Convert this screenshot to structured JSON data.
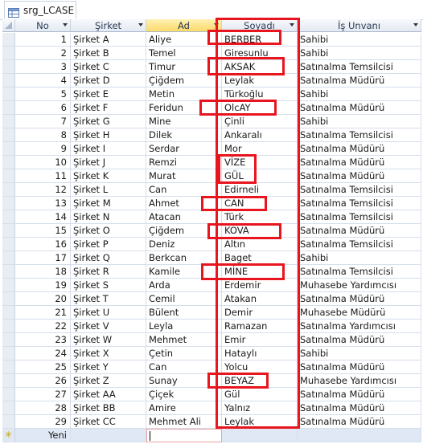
{
  "tab": {
    "label": "srg_LCASE",
    "icon": "table-icon"
  },
  "columns": [
    {
      "key": "no",
      "label": "No"
    },
    {
      "key": "sirket",
      "label": "Şirket"
    },
    {
      "key": "ad",
      "label": "Ad"
    },
    {
      "key": "soyadi",
      "label": "Soyadı"
    },
    {
      "key": "unvan",
      "label": "İş Unvanı"
    }
  ],
  "rows": [
    {
      "no": "1",
      "sirket": "Şirket A",
      "ad": "Aliye",
      "soyadi": "BERBER",
      "unvan": "Sahibi"
    },
    {
      "no": "2",
      "sirket": "Şirket B",
      "ad": "Temel",
      "soyadi": "Giresunlu",
      "unvan": "Sahibi"
    },
    {
      "no": "3",
      "sirket": "Şirket C",
      "ad": "Timur",
      "soyadi": "AKSAK",
      "unvan": "Satınalma Temsilcisi"
    },
    {
      "no": "4",
      "sirket": "Şirket D",
      "ad": "Çiğdem",
      "soyadi": "Leylak",
      "unvan": "Satınalma Müdürü"
    },
    {
      "no": "5",
      "sirket": "Şirket E",
      "ad": "Metin",
      "soyadi": "Türkoğlu",
      "unvan": "Sahibi"
    },
    {
      "no": "6",
      "sirket": "Şirket F",
      "ad": "Feridun",
      "soyadi": "OlcAY",
      "unvan": "Satınalma Müdürü"
    },
    {
      "no": "7",
      "sirket": "Şirket G",
      "ad": "Mine",
      "soyadi": "Çinli",
      "unvan": "Sahibi"
    },
    {
      "no": "8",
      "sirket": "Şirket H",
      "ad": "Dilek",
      "soyadi": "Ankaralı",
      "unvan": "Satınalma Temsilcisi"
    },
    {
      "no": "9",
      "sirket": "Şirket I",
      "ad": "Serdar",
      "soyadi": "Mor",
      "unvan": "Satınalma Müdürü"
    },
    {
      "no": "10",
      "sirket": "Şirket J",
      "ad": "Remzi",
      "soyadi": "VİZE",
      "unvan": "Satınalma Müdürü"
    },
    {
      "no": "11",
      "sirket": "Şirket K",
      "ad": "Murat",
      "soyadi": "GÜL",
      "unvan": "Satınalma Müdürü"
    },
    {
      "no": "12",
      "sirket": "Şirket L",
      "ad": "Can",
      "soyadi": "Edirneli",
      "unvan": "Satınalma Temsilcisi"
    },
    {
      "no": "13",
      "sirket": "Şirket M",
      "ad": "Ahmet",
      "soyadi": "CAN",
      "unvan": "Satınalma Temsilcisi"
    },
    {
      "no": "14",
      "sirket": "Şirket N",
      "ad": "Atacan",
      "soyadi": "Türk",
      "unvan": "Satınalma Temsilcisi"
    },
    {
      "no": "15",
      "sirket": "Şirket O",
      "ad": "Çiğdem",
      "soyadi": "KOVA",
      "unvan": "Satınalma Müdürü"
    },
    {
      "no": "16",
      "sirket": "Şirket P",
      "ad": "Deniz",
      "soyadi": "Altın",
      "unvan": "Satınalma Temsilcisi"
    },
    {
      "no": "17",
      "sirket": "Şirket Q",
      "ad": "Berkcan",
      "soyadi": "Baget",
      "unvan": "Sahibi"
    },
    {
      "no": "18",
      "sirket": "Şirket R",
      "ad": "Kamile",
      "soyadi": "MİNE",
      "unvan": "Satınalma Temsilcisi"
    },
    {
      "no": "19",
      "sirket": "Şirket S",
      "ad": "Arda",
      "soyadi": "Erdemir",
      "unvan": "Muhasebe Yardımcısı"
    },
    {
      "no": "20",
      "sirket": "Şirket T",
      "ad": "Cemil",
      "soyadi": "Atakan",
      "unvan": "Satınalma Müdürü"
    },
    {
      "no": "21",
      "sirket": "Şirket U",
      "ad": "Bülent",
      "soyadi": "Demir",
      "unvan": "Muhasebe Müdürü"
    },
    {
      "no": "22",
      "sirket": "Şirket V",
      "ad": "Leyla",
      "soyadi": "Ramazan",
      "unvan": "Satınalma Yardımcısı"
    },
    {
      "no": "23",
      "sirket": "Şirket W",
      "ad": "Mehmet",
      "soyadi": "Emir",
      "unvan": "Satınalma Müdürü"
    },
    {
      "no": "24",
      "sirket": "Şirket X",
      "ad": "Çetin",
      "soyadi": "Hataylı",
      "unvan": "Sahibi"
    },
    {
      "no": "25",
      "sirket": "Şirket Y",
      "ad": "Can",
      "soyadi": "Yolcu",
      "unvan": "Satınalma Müdürü"
    },
    {
      "no": "26",
      "sirket": "Şirket Z",
      "ad": "Sunay",
      "soyadi": "BEYAZ",
      "unvan": "Muhasebe Yardımcısı"
    },
    {
      "no": "27",
      "sirket": "Şirket AA",
      "ad": "Çiçek",
      "soyadi": "Gül",
      "unvan": "Satınalma Müdürü"
    },
    {
      "no": "28",
      "sirket": "Şirket BB",
      "ad": "Amire",
      "soyadi": "Yalnız",
      "unvan": "Satınalma Müdürü"
    },
    {
      "no": "29",
      "sirket": "Şirket CC",
      "ad": "Mehmet Ali",
      "soyadi": "Leylak",
      "unvan": "Satınalma Müdürü"
    }
  ],
  "new_row": {
    "no": "Yeni",
    "marker": "✳"
  },
  "colors": {
    "highlight": "#e8141e",
    "header_selected": "#fbd86a",
    "new_row": "#dfe8f4"
  }
}
